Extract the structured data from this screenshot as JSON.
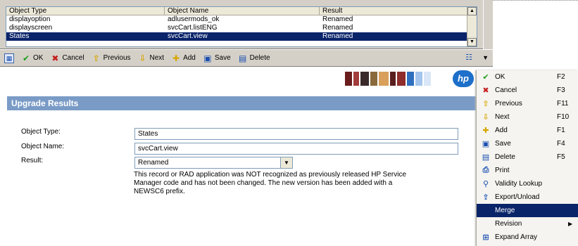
{
  "grid": {
    "headers": [
      "Object Type",
      "Object Name",
      "Result"
    ],
    "rows": [
      {
        "type": "displayoption",
        "name": "adlusermods_ok",
        "result": "Renamed"
      },
      {
        "type": "displayscreen",
        "name": "svcCart.listENG",
        "result": "Renamed"
      },
      {
        "type": "States",
        "name": "svcCart.view",
        "result": "Renamed"
      }
    ],
    "selected_row": 2
  },
  "toolbar": {
    "ok": "OK",
    "cancel": "Cancel",
    "previous": "Previous",
    "next": "Next",
    "add": "Add",
    "save": "Save",
    "delete": "Delete"
  },
  "section": {
    "title": "Upgrade Results"
  },
  "form": {
    "object_type_label": "Object Type:",
    "object_type_value": "States",
    "object_name_label": "Object Name:",
    "object_name_value": "svcCart.view",
    "result_label": "Result:",
    "result_value": "Renamed",
    "note": "This record or RAD application was NOT recognized as previously released HP Service Manager code and has not been changed.  The new version has been added with a NEWSC6 prefix."
  },
  "context_menu": {
    "items": [
      {
        "label": "OK",
        "key": "F2",
        "icon": "check-icon"
      },
      {
        "label": "Cancel",
        "key": "F3",
        "icon": "cancel-icon"
      },
      {
        "label": "Previous",
        "key": "F11",
        "icon": "up-arrow-icon"
      },
      {
        "label": "Next",
        "key": "F10",
        "icon": "down-arrow-icon"
      },
      {
        "label": "Add",
        "key": "F1",
        "icon": "add-icon"
      },
      {
        "label": "Save",
        "key": "F4",
        "icon": "save-icon"
      },
      {
        "label": "Delete",
        "key": "F5",
        "icon": "delete-icon"
      },
      {
        "label": "Print",
        "key": "",
        "icon": "print-icon"
      },
      {
        "label": "Validity Lookup",
        "key": "",
        "icon": "lookup-icon"
      },
      {
        "label": "Export/Unload",
        "key": "",
        "icon": "export-icon"
      },
      {
        "label": "Merge",
        "key": "",
        "icon": ""
      },
      {
        "label": "Revision",
        "key": "",
        "icon": ""
      },
      {
        "label": "Expand Array",
        "key": "",
        "icon": "expand-array-icon"
      }
    ],
    "highlighted_index": 10
  },
  "colors": {
    "selection": "#0a246a",
    "section_header": "#7a9bc6",
    "toolbar_bg": "#d4d0c8"
  }
}
